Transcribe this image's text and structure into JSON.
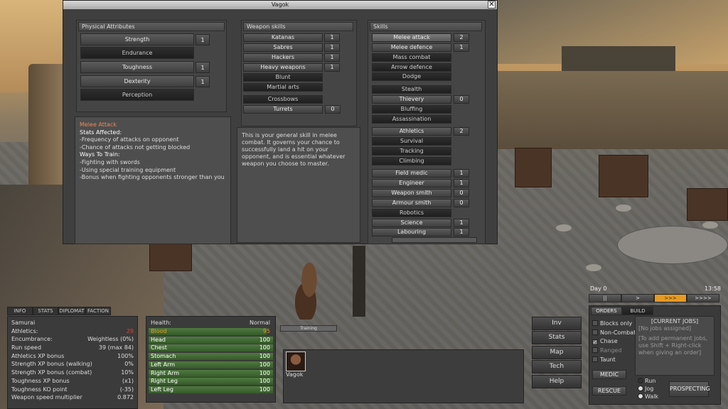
{
  "window": {
    "title": "Vagok",
    "close_label": "✕"
  },
  "attributes": {
    "title": "Physical Attributes",
    "items": [
      {
        "label": "Strength",
        "value": "1"
      },
      {
        "label": "Endurance",
        "value": ""
      },
      {
        "label": "Toughness",
        "value": "1"
      },
      {
        "label": "Dexterity",
        "value": "1"
      },
      {
        "label": "Perception",
        "value": ""
      }
    ]
  },
  "weapon_skills": {
    "title": "Weapon skills",
    "items": [
      {
        "label": "Katanas",
        "value": "1"
      },
      {
        "label": "Sabres",
        "value": "1"
      },
      {
        "label": "Hackers",
        "value": "1"
      },
      {
        "label": "Heavy weapons",
        "value": "1"
      },
      {
        "label": "Blunt",
        "value": ""
      },
      {
        "label": "Martial arts",
        "value": ""
      },
      {
        "label": "Crossbows",
        "value": ""
      },
      {
        "label": "Turrets",
        "value": "0"
      }
    ]
  },
  "skills": {
    "title": "Skills",
    "items": [
      {
        "label": "Melee attack",
        "value": "2"
      },
      {
        "label": "Melee defence",
        "value": "1"
      },
      {
        "label": "Mass combat",
        "value": ""
      },
      {
        "label": "Arrow defence",
        "value": ""
      },
      {
        "label": "Dodge",
        "value": ""
      },
      {
        "label": "Stealth",
        "value": ""
      },
      {
        "label": "Thievery",
        "value": "0"
      },
      {
        "label": "Bluffing",
        "value": ""
      },
      {
        "label": "Assassination",
        "value": ""
      },
      {
        "label": "Athletics",
        "value": "2"
      },
      {
        "label": "Survival",
        "value": ""
      },
      {
        "label": "Tracking",
        "value": ""
      },
      {
        "label": "Climbing",
        "value": ""
      },
      {
        "label": "Field medic",
        "value": "1"
      },
      {
        "label": "Engineer",
        "value": "1"
      },
      {
        "label": "Weapon smith",
        "value": "0"
      },
      {
        "label": "Armour smith",
        "value": "0"
      },
      {
        "label": "Robotics",
        "value": ""
      },
      {
        "label": "Science",
        "value": "1"
      },
      {
        "label": "Labouring",
        "value": "1"
      }
    ]
  },
  "info": {
    "heading": "Melee Attack",
    "stats_label": "Stats Affected:",
    "stats": [
      "-Frequency of attacks on opponent",
      "-Chance of attacks not getting blocked"
    ],
    "train_label": "Ways To Train:",
    "train": [
      "-Fighting with swords",
      "-Using special training equipment",
      "-Bonus when fighting opponents stronger than you"
    ],
    "description": "This is your general skill in melee combat. It governs your chance to successfully land a hit on your opponent, and is essential whatever weapon you choose to master."
  },
  "tabs": [
    "INFO",
    "STATS",
    "DIPLOMAT",
    "FACTION"
  ],
  "stats_panel": {
    "name": "Samurai",
    "rows": [
      {
        "label": "Athletics:",
        "value": "29"
      },
      {
        "label": "Encumbrance:",
        "value": "Weightless (0%)"
      },
      {
        "label": "Run speed",
        "value": "39 (max 84)"
      },
      {
        "label": "Athletics XP bonus",
        "value": "100%"
      },
      {
        "label": "Strength XP bonus (walking)",
        "value": "0%"
      },
      {
        "label": "Strength XP bonus (combat)",
        "value": "10%"
      },
      {
        "label": "Toughness XP bonus",
        "value": "(x1)"
      },
      {
        "label": "Toughness KO point",
        "value": "(-35)"
      },
      {
        "label": "Weapon speed multiplier",
        "value": "0.872"
      }
    ]
  },
  "health": {
    "label": "Health:",
    "status": "Normal",
    "rows": [
      {
        "label": "Blood",
        "value": "95",
        "fill": 0.95
      },
      {
        "label": "Head",
        "value": "100",
        "fill": 1
      },
      {
        "label": "Chest",
        "value": "100",
        "fill": 1
      },
      {
        "label": "Stomach",
        "value": "100",
        "fill": 1
      },
      {
        "label": "Left Arm",
        "value": "100",
        "fill": 1
      },
      {
        "label": "Right Arm",
        "value": "100",
        "fill": 1
      },
      {
        "label": "Right Leg",
        "value": "100",
        "fill": 1
      },
      {
        "label": "Left Leg",
        "value": "100",
        "fill": 1
      }
    ]
  },
  "world": {
    "status_bubble": "Training"
  },
  "squad": {
    "member_name": "Vagok"
  },
  "side_buttons": [
    "Inv",
    "Stats",
    "Map",
    "Tech",
    "Help"
  ],
  "time": {
    "day": "Day 0",
    "clock": "13:58",
    "speeds": [
      "||",
      ">",
      ">>>",
      ">>>>"
    ]
  },
  "orders": {
    "tabs": [
      "ORDERS",
      "BUILD"
    ],
    "checkboxes": [
      "Blocks only",
      "Non-Combat",
      "Chase",
      "Ranged",
      "Taunt"
    ],
    "current_jobs_title": "[CURRENT JOBS]",
    "no_jobs": "[No jobs assigned]",
    "hint": "[To add permanent jobs, use Shift + Right-click when giving an order]",
    "medic": "MEDIC",
    "rescue": "RESCUE",
    "movement": [
      "Run",
      "Jog",
      "Walk"
    ],
    "prospecting": "PROSPECTING"
  },
  "colors": {
    "accent_orange": "#e89a20",
    "heading_orange": "#e8895a",
    "athletics_red": "#d04a3a",
    "health_green": "#4f7a3f"
  }
}
